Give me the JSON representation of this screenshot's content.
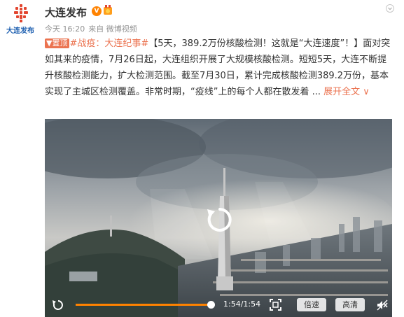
{
  "account": {
    "avatar_text": "大连发布",
    "name": "大连发布",
    "verified_label": "V",
    "time": "今天 16:20",
    "source": "来自 微博视频"
  },
  "post": {
    "pin_label": "置顶",
    "topic": "#战疫：大连纪事#",
    "text_part1": "【5天，389.2万份核酸检测！这就是“大连速度”！】面对突如其来的疫情，7月26日起，大连组织开展了大规模核酸检测。短短5天，大连不断提升核酸检测能力，扩大检测范围。截至7月30日，累计完成核酸检测389.2万份，基本实现了主城区检测覆盖。非常时期，“疫线”上的每个人都在散发着 ... ",
    "expand_label": "展开全文",
    "expand_icon": "∨"
  },
  "video": {
    "replay_icon": "replay-icon",
    "progress": 1.0,
    "time_text": "1:54/1:54",
    "speed_label": "倍速",
    "quality_label": "高清",
    "colors": {
      "progress_fill": "#ff8200",
      "sky_top": "#7e8a94",
      "sky_mid": "#b9bcbf",
      "city": "#59636b"
    }
  },
  "colors": {
    "accent": "#eb7350",
    "vip": "#ff8200",
    "meta": "#939393"
  }
}
